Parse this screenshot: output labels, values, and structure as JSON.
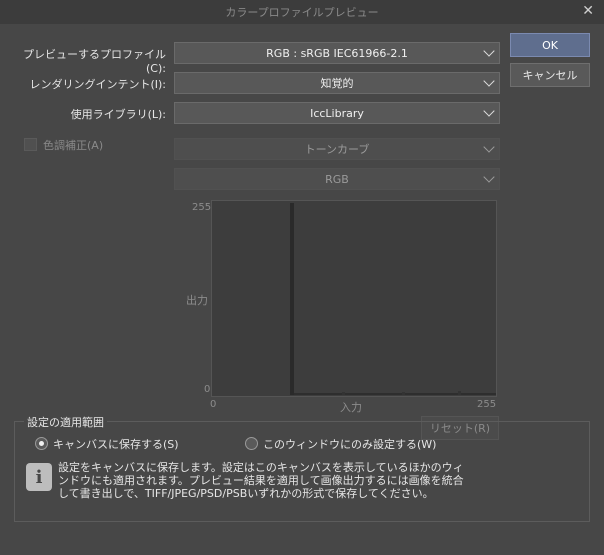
{
  "window": {
    "title": "カラープロファイルプレビュー"
  },
  "form": {
    "profile_label": "プレビューするプロファイル(C):",
    "profile_value": "RGB : sRGB IEC61966-2.1",
    "intent_label": "レンダリングインテント(I):",
    "intent_value": "知覚的",
    "library_label": "使用ライブラリ(L):",
    "library_value": "IccLibrary",
    "color_correction_label": "色調補正(A)",
    "curve_value": "トーンカーブ",
    "channel_value": "RGB"
  },
  "buttons": {
    "ok": "OK",
    "cancel": "キャンセル",
    "reset": "リセット(R)"
  },
  "graph": {
    "y_max": "255",
    "y_min": "0",
    "y_label": "出力",
    "x_min": "0",
    "x_max": "255",
    "x_label": "入力"
  },
  "scope": {
    "title": "設定の適用範囲",
    "option_canvas": "キャンバスに保存する(S)",
    "option_window": "このウィンドウにのみ設定する(W)",
    "selected": "option_canvas",
    "info_line1": "設定をキャンバスに保存します。設定はこのキャンバスを表示しているほかのウィ",
    "info_line2": "ンドウにも適用されます。プレビュー結果を適用して画像出力するには画像を統合",
    "info_line3": "して書き出しで、TIFF/JPEG/PSD/PSBいずれかの形式で保存してください。"
  },
  "icons": {
    "close": "close-icon",
    "info": "info-icon",
    "dropdown": "chevron-down-icon"
  }
}
